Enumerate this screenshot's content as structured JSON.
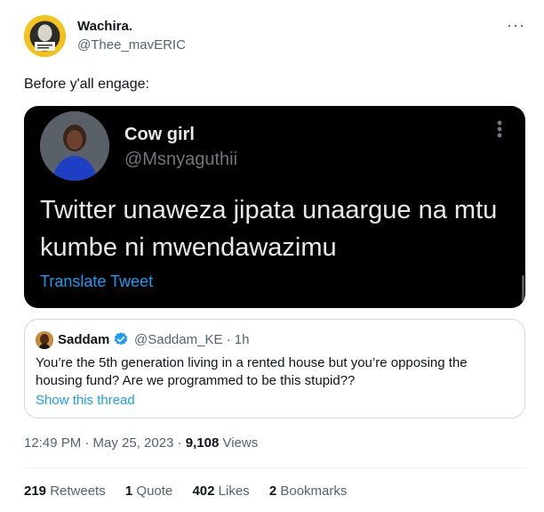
{
  "author": {
    "name": "Wachira.",
    "handle": "@Thee_mavERIC"
  },
  "more_glyph": "···",
  "tweet_text": "Before y'all engage:",
  "media": {
    "name": "Cow girl",
    "handle": "@Msnyaguthii",
    "text": "Twitter unaweza jipata unaargue na mtu kumbe ni mwendawazimu",
    "translate_label": "Translate Tweet",
    "more_glyph": "⋮"
  },
  "quote": {
    "name": "Saddam",
    "handle_time": "@Saddam_KE · 1h",
    "text": "You’re the 5th generation living in a rented house but you’re opposing the housing fund? Are we programmed to be this stupid??",
    "show_thread": "Show this thread"
  },
  "meta": {
    "time_date": "12:49 PM · May 25, 2023 · ",
    "views_count": "9,108",
    "views_label": " Views"
  },
  "stats": {
    "retweets_count": "219",
    "retweets_label": " Retweets",
    "quotes_count": "1",
    "quotes_label": " Quote",
    "likes_count": "402",
    "likes_label": " Likes",
    "bookmarks_count": "2",
    "bookmarks_label": " Bookmarks"
  },
  "colors": {
    "link": "#1d9bf0",
    "secondary_text": "#536471",
    "media_background": "#000000",
    "author_avatar": "#f3c21b"
  }
}
